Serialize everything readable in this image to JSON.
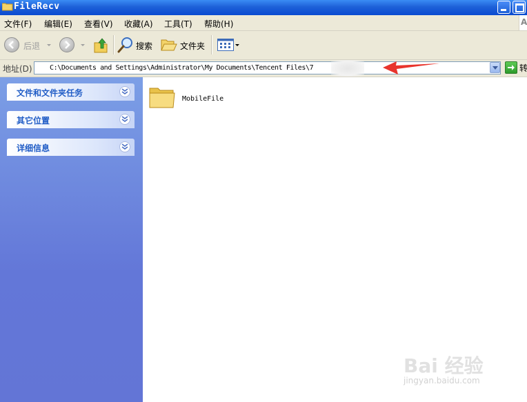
{
  "window": {
    "title": "FileRecv"
  },
  "menu": {
    "items": [
      "文件(F)",
      "编辑(E)",
      "查看(V)",
      "收藏(A)",
      "工具(T)",
      "帮助(H)"
    ],
    "corner_glyph": "A"
  },
  "toolbar": {
    "back_label": "后退",
    "search_label": "搜索",
    "folders_label": "文件夹"
  },
  "address": {
    "label": "地址(D)",
    "path": "C:\\Documents and Settings\\Administrator\\My Documents\\Tencent Files\\7",
    "go_label": "转"
  },
  "task_pane": {
    "sections": [
      "文件和文件夹任务",
      "其它位置",
      "详细信息"
    ]
  },
  "files": [
    {
      "name": "MobileFile",
      "type": "folder"
    }
  ],
  "watermark": {
    "main": "Bai 经验",
    "sub": "jingyan.baidu.com"
  },
  "colors": {
    "titlebar": "#1e61d8",
    "pane_header_text": "#215dc6",
    "annotation_arrow": "#e8342c"
  }
}
